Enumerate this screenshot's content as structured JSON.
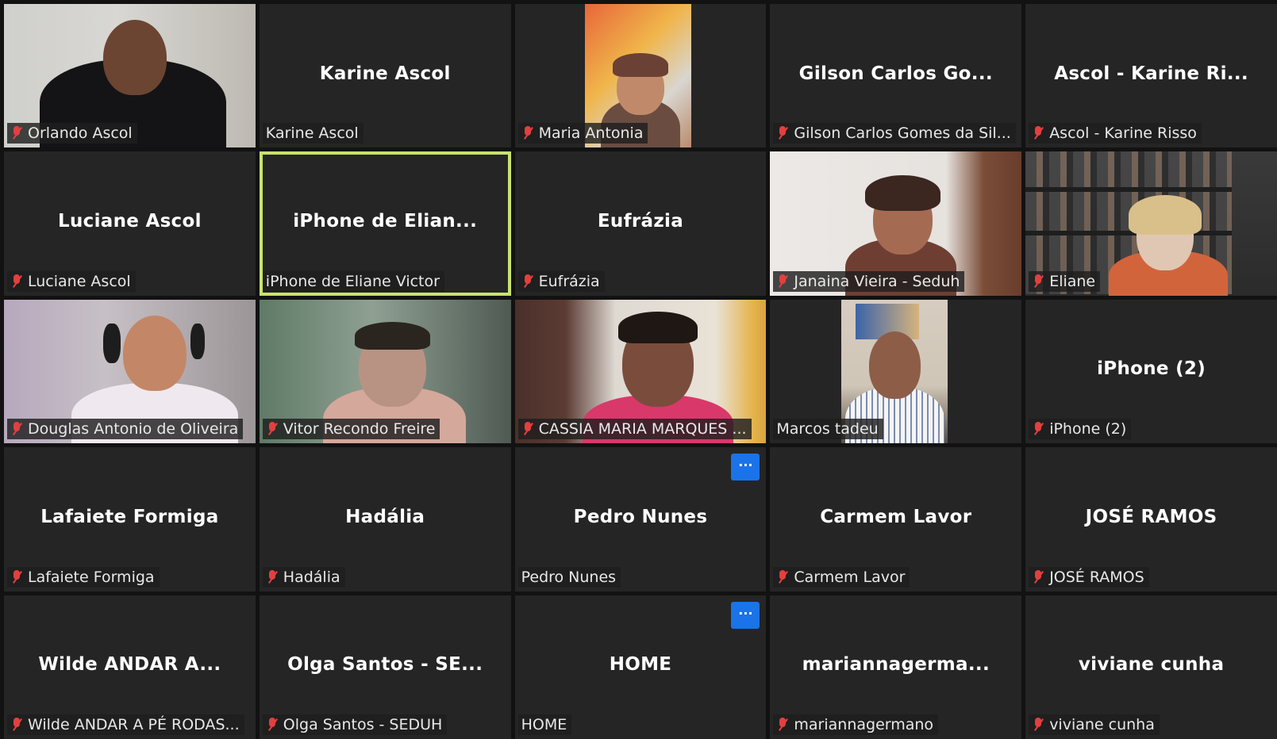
{
  "colors": {
    "background": "#121212",
    "tile": "#252525",
    "active_speaker": "#c9e36b",
    "muted_mic": "#e2403f",
    "more_button": "#1a73e8"
  },
  "participants": [
    {
      "center": "",
      "label": "Orlando Ascol",
      "muted": true,
      "video": "orlando"
    },
    {
      "center": "Karine Ascol",
      "label": "Karine Ascol",
      "muted": false
    },
    {
      "center": "",
      "label": "Maria Antonia",
      "muted": true,
      "video": "maria"
    },
    {
      "center": "Gilson Carlos Go...",
      "label": "Gilson Carlos Gomes da Sil...",
      "muted": true
    },
    {
      "center": "Ascol - Karine Ri...",
      "label": "Ascol - Karine Risso",
      "muted": true
    },
    {
      "center": "Luciane Ascol",
      "label": "Luciane Ascol",
      "muted": true
    },
    {
      "center": "iPhone de Elian...",
      "label": "iPhone de Eliane Victor",
      "muted": false,
      "active": true
    },
    {
      "center": "Eufrázia",
      "label": "Eufrázia",
      "muted": true
    },
    {
      "center": "",
      "label": "Janaina Vieira - Seduh",
      "muted": true,
      "video": "janaina"
    },
    {
      "center": "",
      "label": "Eliane",
      "muted": true,
      "video": "eliane"
    },
    {
      "center": "",
      "label": "Douglas Antonio de Oliveira",
      "muted": true,
      "video": "douglas"
    },
    {
      "center": "",
      "label": "Vitor Recondo Freire",
      "muted": true,
      "video": "vitor"
    },
    {
      "center": "",
      "label": "CASSIA MARIA MARQUES ...",
      "muted": true,
      "video": "cassia"
    },
    {
      "center": "",
      "label": "Marcos tadeu",
      "muted": false,
      "video": "marcos"
    },
    {
      "center": "iPhone (2)",
      "label": "iPhone (2)",
      "muted": true
    },
    {
      "center": "Lafaiete Formiga",
      "label": "Lafaiete Formiga",
      "muted": true
    },
    {
      "center": "Hadália",
      "label": "Hadália",
      "muted": true
    },
    {
      "center": "Pedro Nunes",
      "label": "Pedro Nunes",
      "muted": false,
      "more": true
    },
    {
      "center": "Carmem Lavor",
      "label": "Carmem Lavor",
      "muted": true
    },
    {
      "center": "JOSÉ RAMOS",
      "label": "JOSÉ RAMOS",
      "muted": true
    },
    {
      "center": "Wilde ANDAR A...",
      "label": "Wilde ANDAR A PÉ RODAS...",
      "muted": true
    },
    {
      "center": "Olga Santos - SE...",
      "label": "Olga Santos - SEDUH",
      "muted": true
    },
    {
      "center": "HOME",
      "label": "HOME",
      "muted": false,
      "more": true
    },
    {
      "center": "mariannagerma...",
      "label": "mariannagermano",
      "muted": true
    },
    {
      "center": "viviane cunha",
      "label": "viviane cunha",
      "muted": true
    }
  ],
  "more_button_glyph": "···"
}
